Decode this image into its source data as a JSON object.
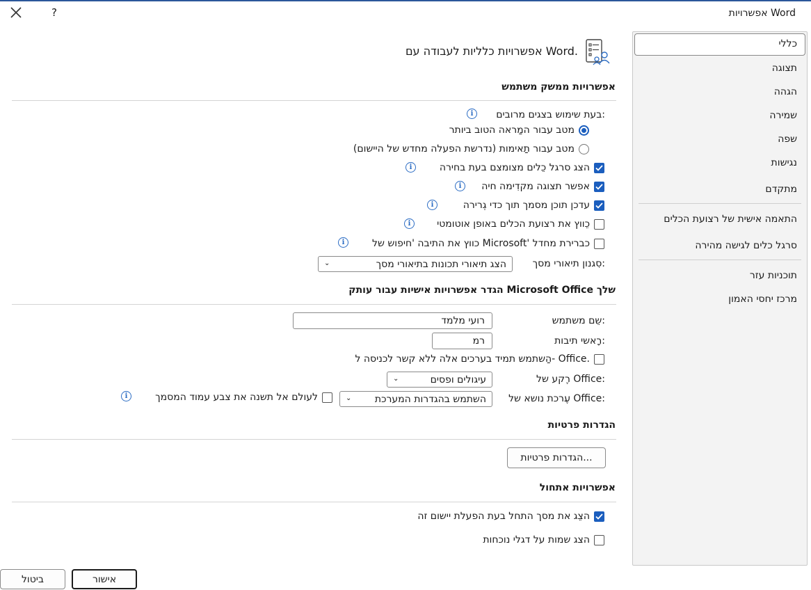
{
  "window": {
    "title": "אפשרויות Word",
    "help": "?"
  },
  "nav": {
    "items": [
      {
        "label": "כללי"
      },
      {
        "label": "תצוגה"
      },
      {
        "label": "הגהה"
      },
      {
        "label": "שמירה"
      },
      {
        "label": "שפה"
      },
      {
        "label": "נגישות"
      },
      {
        "label": "מתקדם"
      },
      {
        "label": "התאמה אישית של רצועת הכלים"
      },
      {
        "label": "סרגל כלים לגישה מהירה"
      },
      {
        "label": "תוכניות עזר"
      },
      {
        "label": "מרכז יחסי האמון"
      }
    ]
  },
  "main": {
    "heading": "אפשרויות כלליות לעבודה עם Word.",
    "ui_section": {
      "title": "אפשרויות ממשק משתמש",
      "multi_display_label": "בעת שימוש בצגים מרובים:",
      "radio_best_appearance": "מטב עבור המַראה הטוב ביותר",
      "radio_compatibility": "מטב עבור תַאימות (נדרשת הפעלה מחדש של היישום)",
      "cb_mini_toolbar": "הצג סרגל כֵלים מצומצם בעת בחירה",
      "cb_live_preview": "אפשר תצוגה מקדִימה חיה",
      "cb_update_drag": "עדכן תוכן מסמך תוך כדי גְרירה",
      "cb_collapse_ribbon": "כֵווץ את רצועת הכלים באופן אוטומטי",
      "cb_collapse_search": "כווץ את התיבה 'חיפוש של Microsoft' כברירת מחדל",
      "screentip_label": "סִגנון תיאורי מסך:",
      "screentip_value": "הצג תיאורי תכונות בתיאורי מסך"
    },
    "personalize_section": {
      "title": "הגדר אפשרויות אישיות עבור עותק Microsoft Office שלך",
      "username_label": "שֵם משתמש:",
      "username_value": "רועי מלמד",
      "initials_label": "רָאשי תיבות:",
      "initials_value": "רמ",
      "cb_always_use": "הַשתמש תמיד בערכים אלה ללא קשר לכניסה ל- Office.",
      "background_label": "רֶקע של Office:",
      "background_value": "עיגולים ופסים",
      "theme_label": "עֶרכת נושא של Office:",
      "theme_value": "השתמש בהגדרות המערכת",
      "cb_never_change": "לעולם אל תשנה את צבע עמוד המסמך"
    },
    "privacy_section": {
      "title": "הגדרות פרטיות",
      "button": "הגדרות פרטיות..."
    },
    "startup_section": {
      "title": "אפשרויות אתחול",
      "cb_show_start": "הצֵג את מסך התחל בעת הפעלת יישום זה",
      "cb_show_names": "הצג שמות על דגלי נוכחות"
    }
  },
  "footer": {
    "ok": "אישור",
    "cancel": "ביטול"
  },
  "colors": {
    "accent": "#1b5ebe",
    "title_bar_line": "#2b579a"
  }
}
